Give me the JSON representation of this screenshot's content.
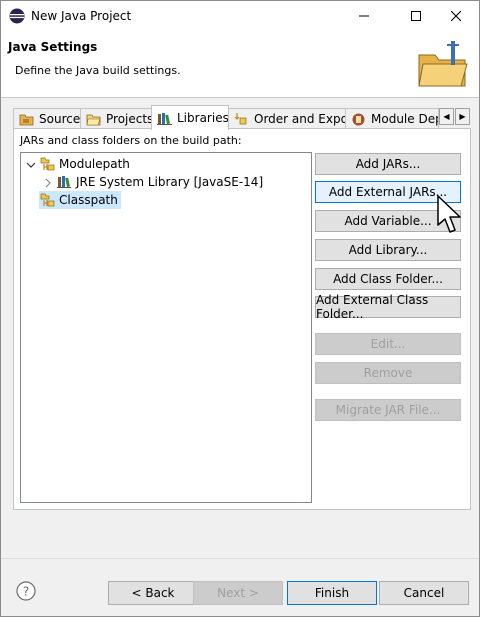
{
  "window": {
    "title": "New Java Project"
  },
  "banner": {
    "title": "Java Settings",
    "description": "Define the Java build settings."
  },
  "tabs": [
    {
      "label": "Source",
      "icon": "source-folder-icon"
    },
    {
      "label": "Projects",
      "icon": "projects-folder-icon"
    },
    {
      "label": "Libraries",
      "icon": "libraries-icon",
      "active": true
    },
    {
      "label": "Order and Export",
      "icon": "order-export-icon"
    },
    {
      "label": "Module Dep",
      "icon": "module-icon"
    }
  ],
  "panel": {
    "label": "JARs and class folders on the build path:",
    "tree": [
      {
        "label": "Modulepath",
        "expanded": true,
        "icon": "classpath-icon"
      },
      {
        "label": "JRE System Library [JavaSE-14]",
        "expanded": false,
        "icon": "library-icon"
      },
      {
        "label": "Classpath",
        "selected": true,
        "icon": "classpath-icon"
      }
    ],
    "buttons": {
      "add_jars": "Add JARs...",
      "add_external_jars": "Add External JARs...",
      "add_variable": "Add Variable...",
      "add_library": "Add Library...",
      "add_class_folder": "Add Class Folder...",
      "add_external_class_folder": "Add External Class Folder...",
      "edit": "Edit...",
      "remove": "Remove",
      "migrate_jar": "Migrate JAR File..."
    }
  },
  "footer": {
    "back": "< Back",
    "next": "Next >",
    "finish": "Finish",
    "cancel": "Cancel"
  },
  "colors": {
    "selection": "#cce8ff",
    "focus_border": "#0078d7",
    "disabled_text": "#a0a0a0"
  }
}
